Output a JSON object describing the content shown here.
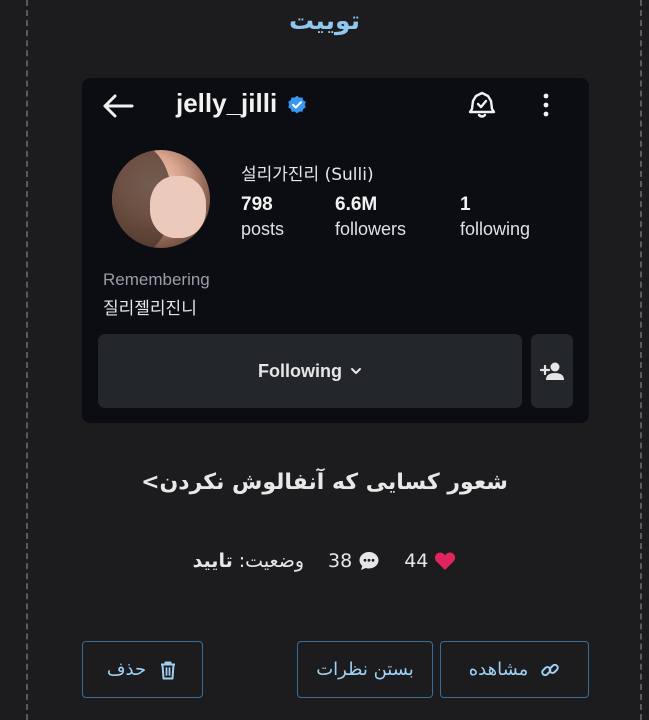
{
  "header": {
    "title": "توییت"
  },
  "profile_card": {
    "username": "jelly_jilli",
    "full_name": "설리가진리 (Sulli)",
    "stats": [
      {
        "value": "798",
        "label": "posts"
      },
      {
        "value": "6.6M",
        "label": "followers"
      },
      {
        "value": "1",
        "label": "following"
      }
    ],
    "remembering": "Remembering",
    "bio": "질리젤리진니",
    "follow_button": "Following",
    "icons": [
      "arrow-left-icon",
      "verified-badge-icon",
      "bell-icon",
      "more-vertical-icon",
      "chevron-down-icon",
      "add-user-icon"
    ]
  },
  "tweet": {
    "text": "شعور کسایی که آنفالوش نکردن>"
  },
  "meta": {
    "likes": "44",
    "comments": "38",
    "status_label": "وضعیت: ",
    "status_value": "تایید"
  },
  "actions": {
    "delete": "حذف",
    "close_comments": "بستن نظرات",
    "view": "مشاهده"
  },
  "colors": {
    "background": "#1c1c1e",
    "card_background": "#0b0d12",
    "accent": "#9fd1f5",
    "title": "#8fc7f0",
    "verified": "#3897f0",
    "heart": "#e0245e"
  }
}
